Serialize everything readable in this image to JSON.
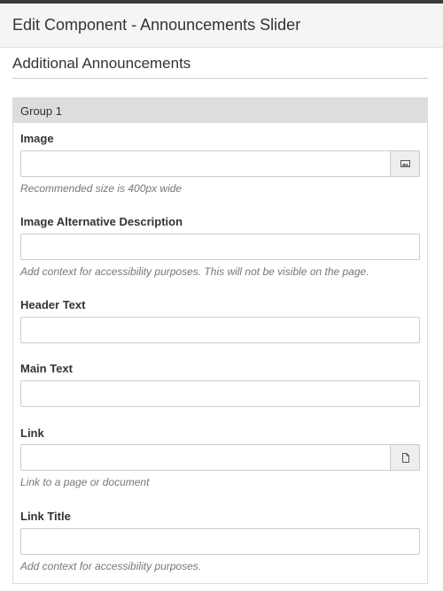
{
  "header": {
    "title": "Edit Component - Announcements Slider"
  },
  "section": {
    "title": "Additional Announcements"
  },
  "group": {
    "title": "Group 1"
  },
  "fields": {
    "image": {
      "label": "Image",
      "value": "",
      "help": "Recommended size is 400px wide",
      "button_icon": "image-icon"
    },
    "image_alt": {
      "label": "Image Alternative Description",
      "value": "",
      "help": "Add context for accessibility purposes. This will not be visible on the page."
    },
    "header_text": {
      "label": "Header Text",
      "value": ""
    },
    "main_text": {
      "label": "Main Text",
      "value": ""
    },
    "link": {
      "label": "Link",
      "value": "",
      "help": "Link to a page or document",
      "button_icon": "document-icon"
    },
    "link_title": {
      "label": "Link Title",
      "value": "",
      "help": "Add context for accessibility purposes."
    }
  }
}
